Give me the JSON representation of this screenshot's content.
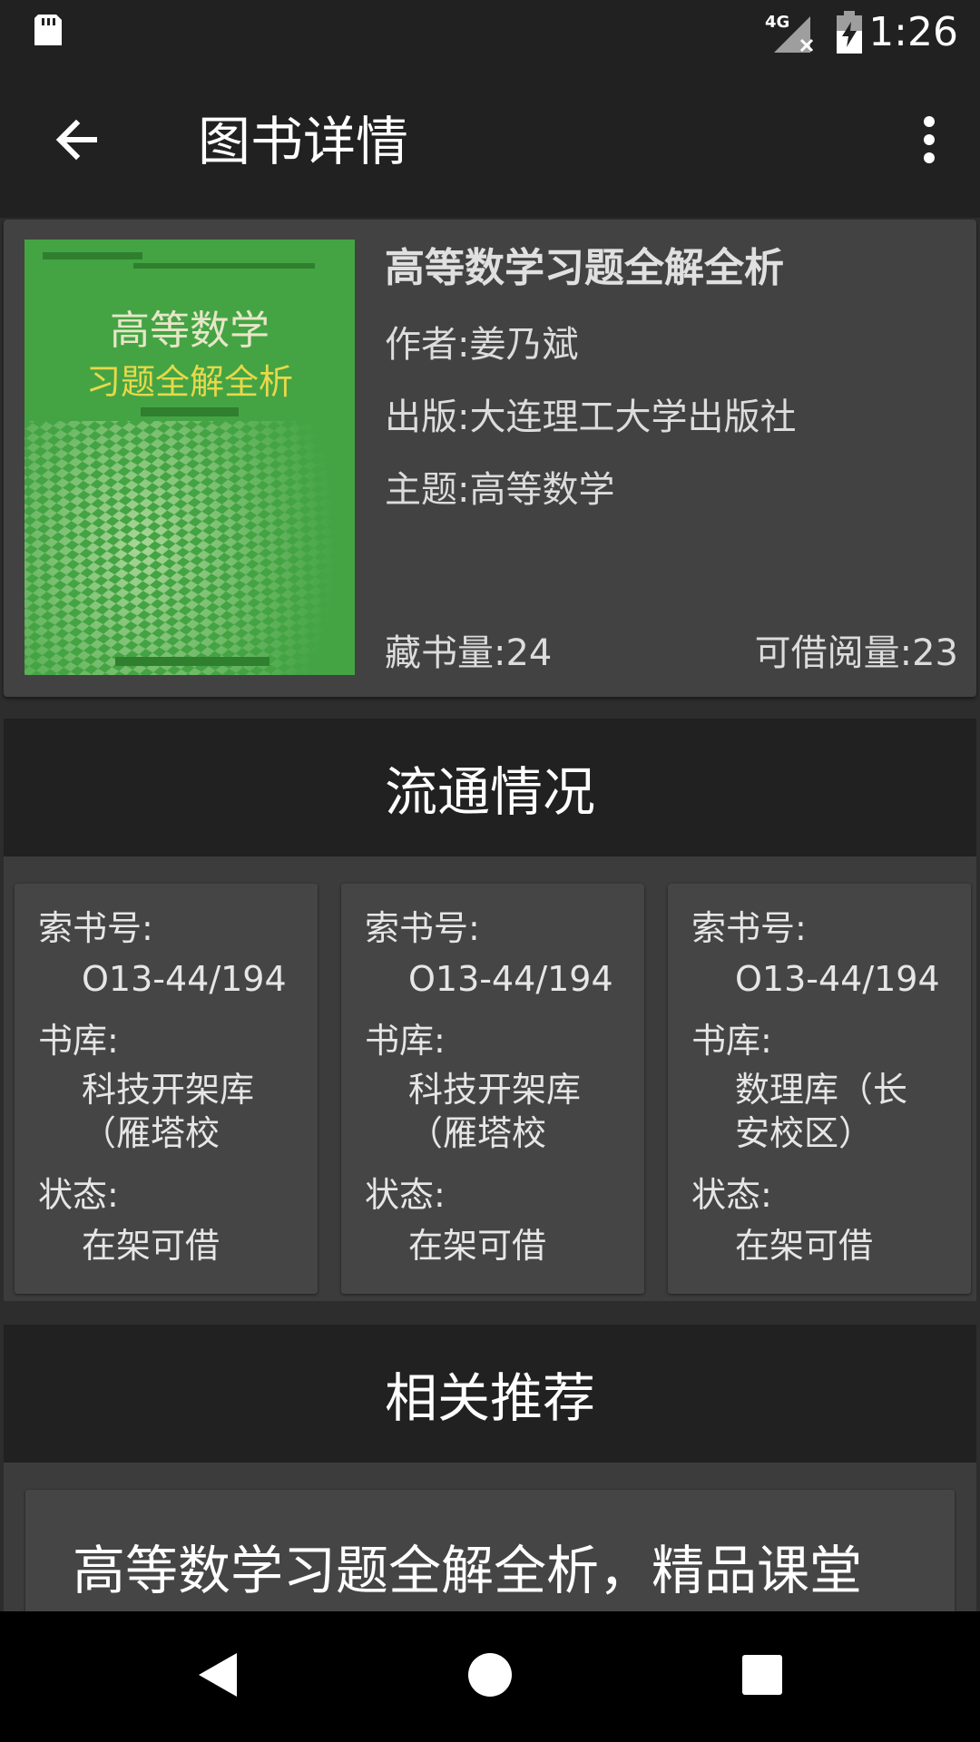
{
  "status_bar": {
    "time": "1:26",
    "network_label": "4G",
    "icons": [
      "sd-card-icon",
      "signal-4g-icon",
      "battery-charging-icon"
    ]
  },
  "app_bar": {
    "title": "图书详情",
    "icons": [
      "back-arrow-icon",
      "more-vert-icon"
    ]
  },
  "book": {
    "title": "高等数学习题全解全析",
    "author": "作者:姜乃斌",
    "publisher": "出版:大连理工大学出版社",
    "subject": "主题:高等数学",
    "holdings": "藏书量:24",
    "available": "可借阅量:23",
    "cover": {
      "line1": "高等数学",
      "line2": "习题全解全析",
      "colors": {
        "background": "#3f9c3e",
        "line1_text": "#e8e6c8",
        "line2_text": "#e8d84a"
      }
    }
  },
  "circulation": {
    "header": "流通情况",
    "label_call_number": "索书号:",
    "label_location": "书库:",
    "label_status": "状态:",
    "copies": [
      {
        "call_number": "O13-44/194",
        "location_line1": "科技开架库",
        "location_line2": "（雁塔校",
        "status": "在架可借"
      },
      {
        "call_number": "O13-44/194",
        "location_line1": "科技开架库",
        "location_line2": "（雁塔校",
        "status": "在架可借"
      },
      {
        "call_number": "O13-44/194",
        "location_line1": "数理库（长",
        "location_line2": "安校区）",
        "status": "在架可借"
      }
    ]
  },
  "recommendations": {
    "header": "相关推荐",
    "items": [
      {
        "title": "高等数学习题全解全析，精品课堂"
      }
    ]
  },
  "nav_bar": {
    "icons": [
      "nav-back-icon",
      "nav-home-icon",
      "nav-recents-icon"
    ]
  },
  "colors": {
    "background": "#2d2d2d",
    "bar": "#212121",
    "card": "#424242",
    "text": "#ffffff"
  }
}
